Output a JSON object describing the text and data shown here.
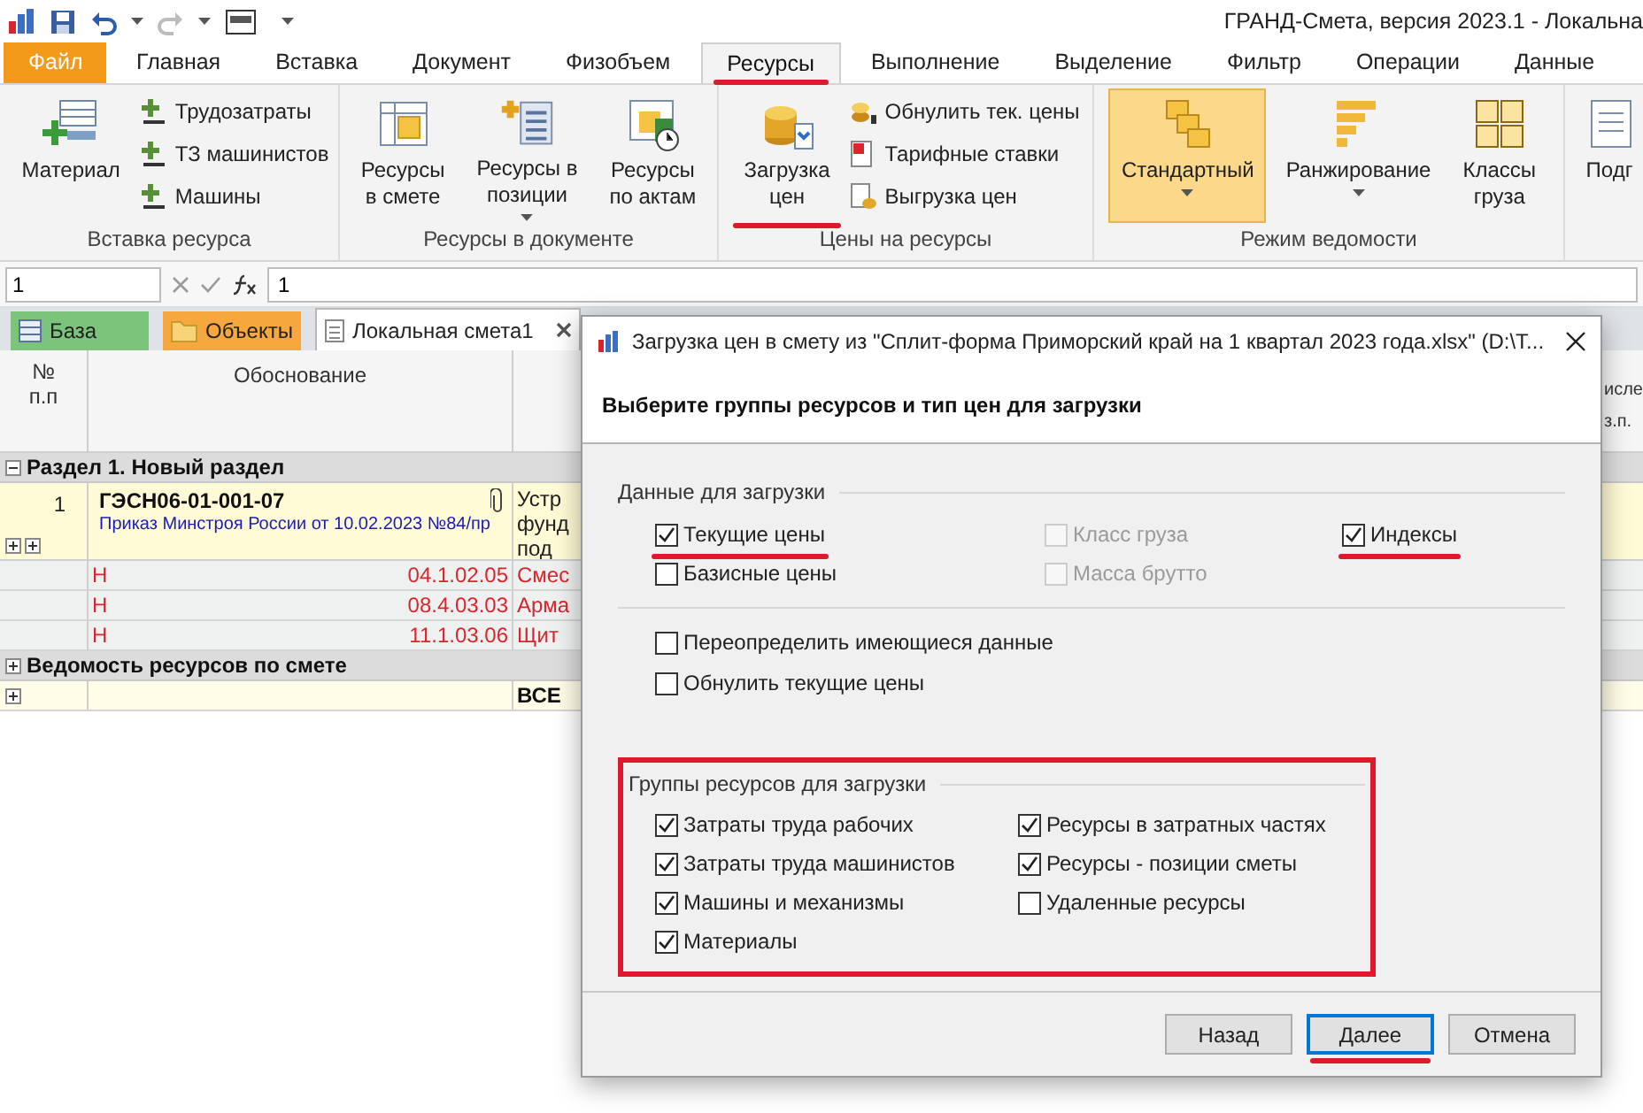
{
  "title_bar": {
    "title": "ГРАНД-Смета, версия 2023.1 - Локальна"
  },
  "ribbon_tabs": [
    {
      "label": "Файл",
      "kind": "file",
      "selected": false,
      "underlined": false
    },
    {
      "label": "Главная",
      "kind": "tab",
      "selected": false,
      "underlined": false
    },
    {
      "label": "Вставка",
      "kind": "tab",
      "selected": false,
      "underlined": false
    },
    {
      "label": "Документ",
      "kind": "tab",
      "selected": false,
      "underlined": false
    },
    {
      "label": "Физобъем",
      "kind": "tab",
      "selected": false,
      "underlined": false
    },
    {
      "label": "Ресурсы",
      "kind": "tab",
      "selected": true,
      "underlined": true
    },
    {
      "label": "Выполнение",
      "kind": "tab",
      "selected": false,
      "underlined": false
    },
    {
      "label": "Выделение",
      "kind": "tab",
      "selected": false,
      "underlined": false
    },
    {
      "label": "Фильтр",
      "kind": "tab",
      "selected": false,
      "underlined": false
    },
    {
      "label": "Операции",
      "kind": "tab",
      "selected": false,
      "underlined": false
    },
    {
      "label": "Данные",
      "kind": "tab",
      "selected": false,
      "underlined": false
    }
  ],
  "ribbon_groups": [
    {
      "label": "Вставка ресурса",
      "items": [
        {
          "kind": "large",
          "label": "Материал",
          "selected": false,
          "has_menu": false,
          "underlined": false
        },
        {
          "kind": "stack",
          "items": [
            "Трудозатраты",
            "ТЗ машинистов",
            "Машины"
          ]
        }
      ]
    },
    {
      "label": "Ресурсы в документе",
      "items": [
        {
          "kind": "large",
          "label": "Ресурсы\nв смете",
          "selected": false,
          "has_menu": false,
          "underlined": false
        },
        {
          "kind": "large",
          "label": "Ресурсы в\nпозиции",
          "selected": false,
          "has_menu": true,
          "underlined": false
        },
        {
          "kind": "large",
          "label": "Ресурсы\nпо актам",
          "selected": false,
          "has_menu": false,
          "underlined": false
        }
      ]
    },
    {
      "label": "Цены на ресурсы",
      "items": [
        {
          "kind": "large",
          "label": "Загрузка\nцен",
          "selected": false,
          "has_menu": false,
          "underlined": true
        },
        {
          "kind": "stack",
          "items": [
            "Обнулить тек. цены",
            "Тарифные ставки",
            "Выгрузка цен"
          ]
        }
      ]
    },
    {
      "label": "Режим ведомости",
      "items": [
        {
          "kind": "large",
          "label": "Стандартный",
          "selected": true,
          "has_menu": true,
          "underlined": false
        },
        {
          "kind": "large",
          "label": "Ранжирование",
          "selected": false,
          "has_menu": true,
          "underlined": false
        },
        {
          "kind": "large",
          "label": "Классы\nгруза",
          "selected": false,
          "has_menu": false,
          "underlined": false
        }
      ]
    },
    {
      "items": [
        {
          "kind": "large",
          "label": "Подг",
          "selected": false,
          "has_menu": false,
          "underlined": false
        }
      ]
    }
  ],
  "formula_bar": {
    "cell": "1",
    "value": "1"
  },
  "doc_tabs": [
    {
      "label": "База",
      "kind": "base",
      "selected": false,
      "closable": false
    },
    {
      "label": "Объекты",
      "kind": "objects",
      "selected": false,
      "closable": false
    },
    {
      "label": "Локальная смета1",
      "kind": "document",
      "selected": true,
      "closable": true
    }
  ],
  "table": {
    "columns": [
      "№\nп.п",
      "Обоснование"
    ],
    "column_4_header": [
      "исле",
      "з.п."
    ],
    "rows": [
      {
        "kind": "section",
        "expanded": true,
        "title": "Раздел 1. Новый раздел"
      },
      {
        "kind": "item",
        "number": "1",
        "code": "ГЭСН06-01-001-07",
        "source": "Приказ Минстроя России от 10.02.2023 №84/пр",
        "attachment": true,
        "column_3": [
          "Устр",
          "фунд",
          "под"
        ]
      },
      {
        "kind": "resource",
        "type": "Н",
        "resource_code": "04.1.02.05",
        "column_3": [
          "Смес"
        ]
      },
      {
        "kind": "resource",
        "type": "Н",
        "resource_code": "08.4.03.03",
        "column_3": [
          "Арма"
        ]
      },
      {
        "kind": "resource",
        "type": "Н",
        "resource_code": "11.1.03.06",
        "column_3": [
          "Щит"
        ]
      },
      {
        "kind": "section",
        "expanded": false,
        "title": "Ведомость ресурсов по смете"
      },
      {
        "kind": "total",
        "column_3": [
          "ВСЕ"
        ]
      }
    ]
  },
  "dialog": {
    "title": "Загрузка цен в смету из \"Сплит-форма Приморский край на 1 квартал 2023 года.xlsx\" (D:\\T...",
    "heading": "Выберите группы ресурсов и тип цен для загрузки",
    "data_section": {
      "label": "Данные для загрузки",
      "options": [
        {
          "label": "Текущие цены",
          "checked": true,
          "disabled": false,
          "underlined": true
        },
        {
          "label": "Класс груза",
          "checked": false,
          "disabled": true,
          "underlined": false
        },
        {
          "label": "Индексы",
          "checked": true,
          "disabled": false,
          "underlined": true
        },
        {
          "label": "Базисные цены",
          "checked": false,
          "disabled": false,
          "underlined": false
        },
        {
          "label": "Масса брутто",
          "checked": false,
          "disabled": true,
          "underlined": false
        }
      ],
      "extra_options": [
        {
          "label": "Переопределить имеющиеся данные",
          "checked": false,
          "disabled": false
        },
        {
          "label": "Обнулить текущие цены",
          "checked": false,
          "disabled": false
        }
      ]
    },
    "groups_section": {
      "label": "Группы ресурсов для загрузки",
      "highlighted": true,
      "options": [
        {
          "label": "Затраты труда рабочих",
          "checked": true,
          "disabled": false,
          "underlined": false
        },
        {
          "label": "Ресурсы в затратных частях",
          "checked": true,
          "disabled": false,
          "underlined": false
        },
        {
          "label": "Затраты труда машинистов",
          "checked": true,
          "disabled": false,
          "underlined": false
        },
        {
          "label": "Ресурсы - позиции сметы",
          "checked": true,
          "disabled": false,
          "underlined": false
        },
        {
          "label": "Машины и механизмы",
          "checked": true,
          "disabled": false,
          "underlined": false
        },
        {
          "label": "Удаленные ресурсы",
          "checked": false,
          "disabled": false,
          "underlined": false
        },
        {
          "label": "Материалы",
          "checked": true,
          "disabled": false,
          "underlined": false
        }
      ]
    },
    "buttons": [
      {
        "label": "Назад",
        "default": false,
        "underlined": false
      },
      {
        "label": "Далее",
        "default": true,
        "underlined": true
      },
      {
        "label": "Отмена",
        "default": false,
        "underlined": false
      }
    ]
  }
}
